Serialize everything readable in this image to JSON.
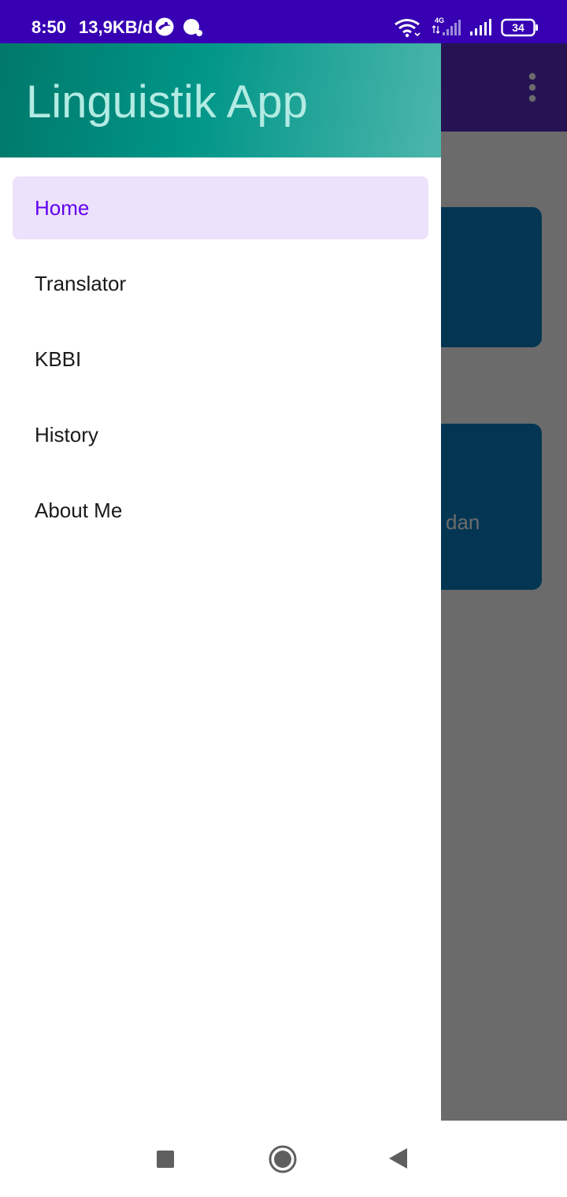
{
  "status_bar": {
    "time": "8:50",
    "network_speed": "13,9KB/d",
    "battery_level": "34",
    "icons": [
      "app-notification-icon",
      "chat-bubble-icon",
      "wifi-icon",
      "4g-signal-icon",
      "cell-signal-icon",
      "battery-icon"
    ],
    "color": "#3700b3"
  },
  "background_app": {
    "toolbar_color": "#5a2ec7",
    "card_color": "#0a82c8",
    "card_2_partial_text": "dan"
  },
  "drawer": {
    "title": "Linguistik App",
    "menu": [
      {
        "label": "Home",
        "selected": true
      },
      {
        "label": "Translator",
        "selected": false
      },
      {
        "label": "KBBI",
        "selected": false
      },
      {
        "label": "History",
        "selected": false
      },
      {
        "label": "About Me",
        "selected": false
      }
    ],
    "selected_color": "#6200ee",
    "selected_background": "#ede2fb"
  },
  "nav_bar": {
    "buttons": [
      "recents-icon",
      "home-icon",
      "back-icon"
    ]
  }
}
